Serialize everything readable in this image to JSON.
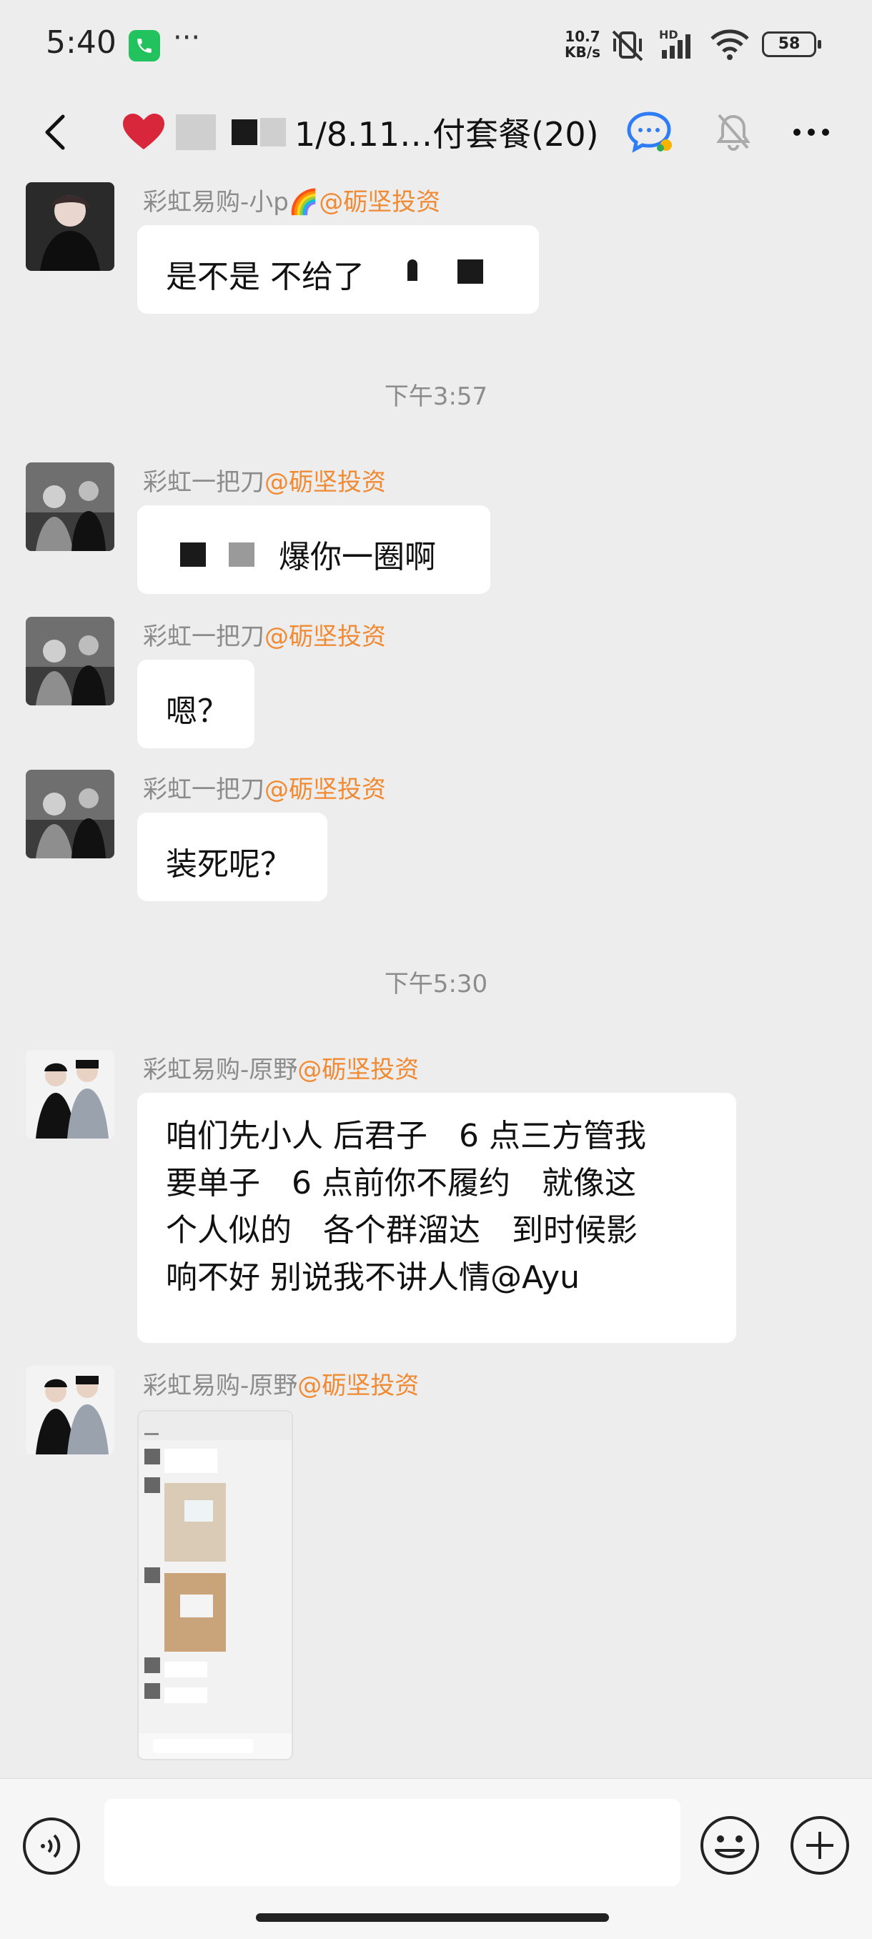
{
  "status_bar": {
    "time": "5:40",
    "more": "···",
    "speed_value": "10.7",
    "speed_unit": "KB/s",
    "battery": "58",
    "icons": [
      "phone-call-icon",
      "mute-vibrate-icon",
      "hd-signal-icon",
      "wifi-icon",
      "battery-icon"
    ]
  },
  "header": {
    "title": "1/8.11…付套餐(20)",
    "icons": [
      "back-icon",
      "group-chat-icon",
      "mute-bell-icon",
      "more-icon"
    ]
  },
  "messages": [
    {
      "sender": "彩虹易购-小p🌈",
      "org": "@砺坚投资",
      "text": "是不是 不给了"
    },
    {
      "timestamp": "下午3:57"
    },
    {
      "sender": "彩虹一把刀",
      "org": "@砺坚投资",
      "text": "爆你一圈啊"
    },
    {
      "sender": "彩虹一把刀",
      "org": "@砺坚投资",
      "text": "嗯？"
    },
    {
      "sender": "彩虹一把刀",
      "org": "@砺坚投资",
      "text": "装死呢？"
    },
    {
      "timestamp": "下午5:30"
    },
    {
      "sender": "彩虹易购-原野",
      "org": "@砺坚投资",
      "lines": [
        "咱们先小人 后君子　6 点三方管我",
        "要单子　6 点前你不履约　就像这",
        "个人似的　各个群溜达　到时候影",
        "响不好 别说我不讲人情@Ayu"
      ]
    },
    {
      "sender": "彩虹易购-原野",
      "org": "@砺坚投资",
      "image": "screenshot-image"
    }
  ],
  "input": {
    "placeholder": ""
  },
  "colors": {
    "background": "#ededed",
    "org_tag": "#f08a33",
    "bubble": "#ffffff",
    "meta_text": "#8c8c8c"
  }
}
